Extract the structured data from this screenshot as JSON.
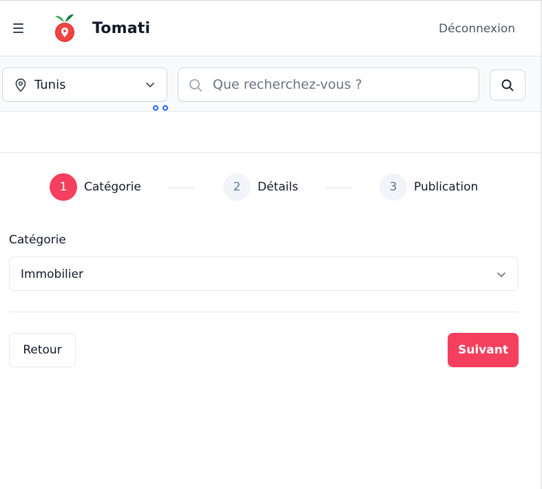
{
  "header": {
    "brand": "Tomati",
    "logout_label": "Déconnexion"
  },
  "search": {
    "location": "Tunis",
    "placeholder": "Que recherchez-vous ?"
  },
  "stepper": {
    "steps": [
      {
        "number": "1",
        "label": "Catégorie",
        "state": "active"
      },
      {
        "number": "2",
        "label": "Détails",
        "state": "pending"
      },
      {
        "number": "3",
        "label": "Publication",
        "state": "pending"
      }
    ]
  },
  "form": {
    "category_label": "Catégorie",
    "category_value": "Immobilier"
  },
  "actions": {
    "back_label": "Retour",
    "next_label": "Suivant"
  },
  "colors": {
    "accent": "#f43f5e",
    "pending_step_bg": "#f1f5f9",
    "border": "#e5e7eb"
  },
  "icons": [
    "menu-icon",
    "tomato-logo-icon",
    "location-pin-icon",
    "chevron-down-icon",
    "search-icon"
  ]
}
